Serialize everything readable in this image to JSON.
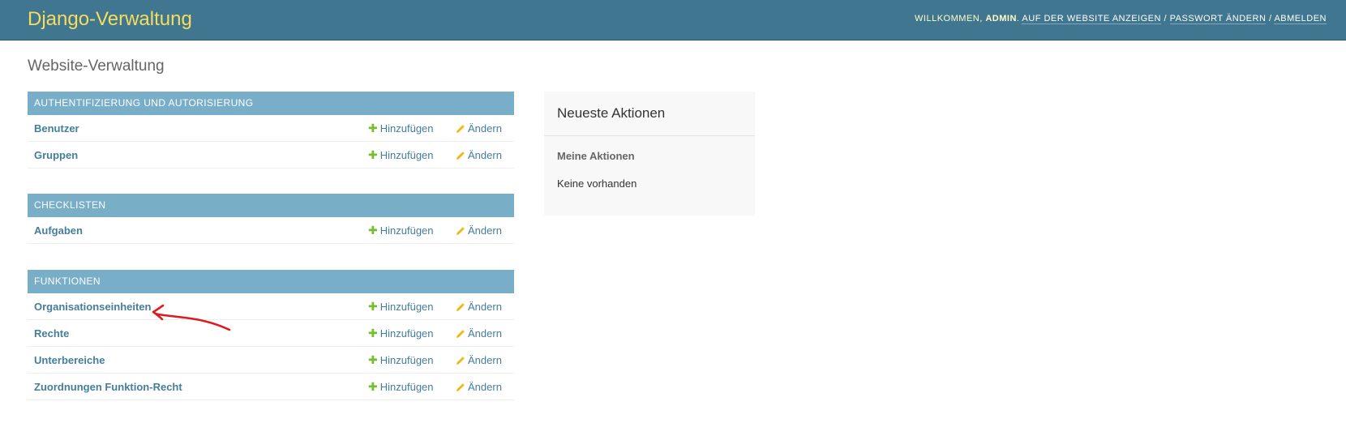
{
  "header": {
    "branding": "Django-Verwaltung",
    "welcome": "Willkommen,",
    "username": "admin",
    "view_site": "Auf der Website anzeigen",
    "change_password": "Passwort ändern",
    "logout": "Abmelden",
    "separator": "/"
  },
  "page_title": "Website-Verwaltung",
  "apps": [
    {
      "caption": "Authentifizierung und Autorisierung",
      "models": [
        {
          "name": "Benutzer",
          "add": "Hinzufügen",
          "change": "Ändern"
        },
        {
          "name": "Gruppen",
          "add": "Hinzufügen",
          "change": "Ändern"
        }
      ]
    },
    {
      "caption": "Checklisten",
      "models": [
        {
          "name": "Aufgaben",
          "add": "Hinzufügen",
          "change": "Ändern"
        }
      ]
    },
    {
      "caption": "Funktionen",
      "models": [
        {
          "name": "Organisationseinheiten",
          "add": "Hinzufügen",
          "change": "Ändern"
        },
        {
          "name": "Rechte",
          "add": "Hinzufügen",
          "change": "Ändern"
        },
        {
          "name": "Unterbereiche",
          "add": "Hinzufügen",
          "change": "Ändern"
        },
        {
          "name": "Zuordnungen Funktion-Recht",
          "add": "Hinzufügen",
          "change": "Ändern"
        }
      ]
    }
  ],
  "recent_actions": {
    "title": "Neueste Aktionen",
    "subtitle": "Meine Aktionen",
    "empty": "Keine vorhanden"
  },
  "colors": {
    "header_bg": "#417690",
    "branding": "#f5dd5d",
    "module_caption_bg": "#79aec8",
    "link": "#447e9b",
    "add_icon": "#70bf2b",
    "change_icon": "#efb80b",
    "annotation": "#e0191e"
  },
  "icons": {
    "add": "plus-icon",
    "change": "pencil-icon",
    "annotation": "red-arrow-annotation"
  }
}
